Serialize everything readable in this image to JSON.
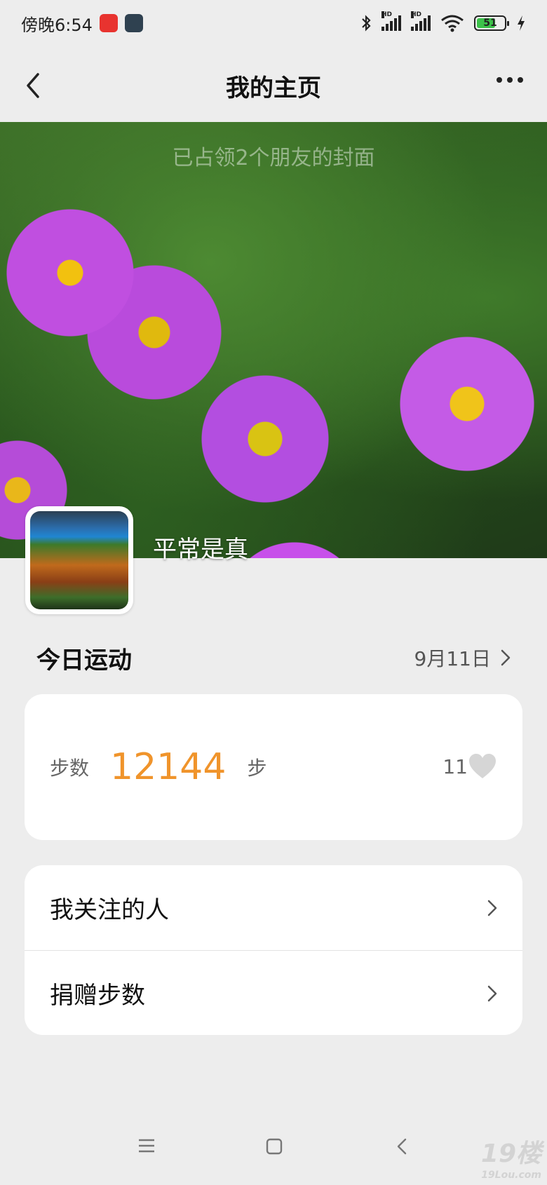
{
  "status_bar": {
    "time": "傍晚6:54",
    "app_icons": [
      "video-app-icon",
      "game-app-icon"
    ],
    "hd1": "HD",
    "hd2": "HD",
    "battery": "51"
  },
  "header": {
    "title": "我的主页",
    "back_icon": "chevron-left-icon",
    "more_icon": "more-dots-icon"
  },
  "cover": {
    "caption": "已占领2个朋友的封面",
    "username": "平常是真"
  },
  "today": {
    "title": "今日运动",
    "date": "9月11日"
  },
  "steps": {
    "label": "步数",
    "value": "12144",
    "unit": "步",
    "likes": "11"
  },
  "menu": {
    "items": [
      {
        "label": "我关注的人"
      },
      {
        "label": "捐赠步数"
      }
    ]
  },
  "watermark": {
    "main": "19楼",
    "sub": "19Lou.com"
  },
  "colors": {
    "accent": "#f0942b",
    "background": "#ededed",
    "card": "#ffffff"
  }
}
